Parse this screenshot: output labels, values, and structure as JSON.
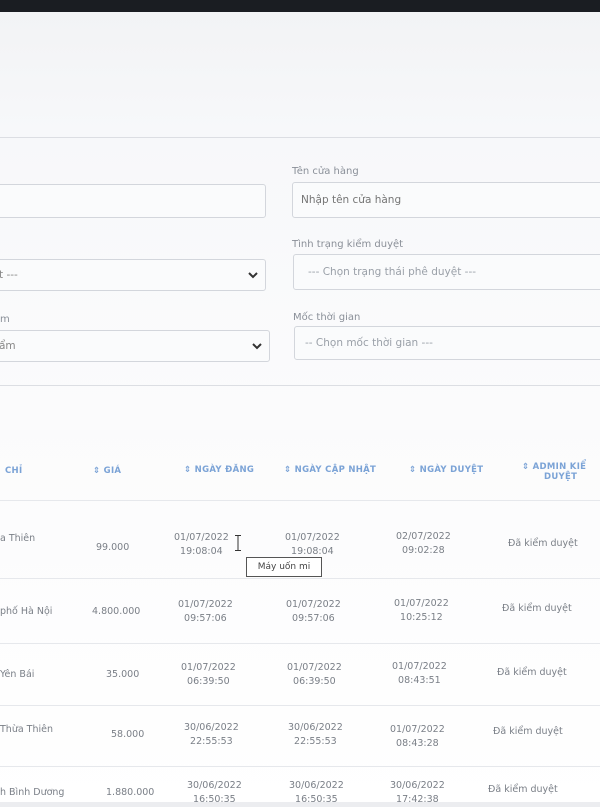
{
  "filters": {
    "store_name": {
      "label": "Tên cửa hàng",
      "placeholder": "Nhập tên cửa hàng"
    },
    "approval_status": {
      "label": "Tình trạng kiểm duyệt",
      "placeholder": "--- Chọn trạng thái phê duyệt ---"
    },
    "left_select_1": {
      "value": "t ---"
    },
    "left_select_2": {
      "label": "m",
      "value": "ẩm"
    },
    "time_milestone": {
      "label": "Mốc thời gian",
      "placeholder": "-- Chọn mốc thời gian ---"
    }
  },
  "table": {
    "headers": {
      "address": "CHỈ",
      "price": "⇕ GIÁ",
      "posted_date": "⇕ NGÀY ĐĂNG",
      "updated_date": "⇕ NGÀY CẬP NHẬT",
      "approved_date": "⇕ NGÀY DUYỆT",
      "admin_1": "⇕ ADMIN KIỂ",
      "admin_2": "DUYỆT"
    },
    "rows": [
      {
        "address": "a Thiên",
        "price": "99.000",
        "posted_1": "01/07/2022",
        "posted_2": "19:08:04",
        "updated_1": "01/07/2022",
        "updated_2": "19:08:04",
        "approved_1": "02/07/2022",
        "approved_2": "09:02:28",
        "status": "Đã kiểm duyệt"
      },
      {
        "address": "phố Hà Nội",
        "price": "4.800.000",
        "posted_1": "01/07/2022",
        "posted_2": "09:57:06",
        "updated_1": "01/07/2022",
        "updated_2": "09:57:06",
        "approved_1": "01/07/2022",
        "approved_2": "10:25:12",
        "status": "Đã kiểm duyệt"
      },
      {
        "address": "Yên Bái",
        "price": "35.000",
        "posted_1": "01/07/2022",
        "posted_2": "06:39:50",
        "updated_1": "01/07/2022",
        "updated_2": "06:39:50",
        "approved_1": "01/07/2022",
        "approved_2": "08:43:51",
        "status": "Đã kiểm duyệt"
      },
      {
        "address": "Thừa Thiên",
        "price": "58.000",
        "posted_1": "30/06/2022",
        "posted_2": "22:55:53",
        "updated_1": "30/06/2022",
        "updated_2": "22:55:53",
        "approved_1": "01/07/2022",
        "approved_2": "08:43:28",
        "status": "Đã kiểm duyệt"
      },
      {
        "address": "h Bình Dương",
        "price": "1.880.000",
        "posted_1": "30/06/2022",
        "posted_2": "16:50:35",
        "updated_1": "30/06/2022",
        "updated_2": "16:50:35",
        "approved_1": "30/06/2022",
        "approved_2": "17:42:38",
        "status": "Đã kiểm duyệt"
      }
    ]
  },
  "tooltip": {
    "text": "Máy uốn mi"
  }
}
